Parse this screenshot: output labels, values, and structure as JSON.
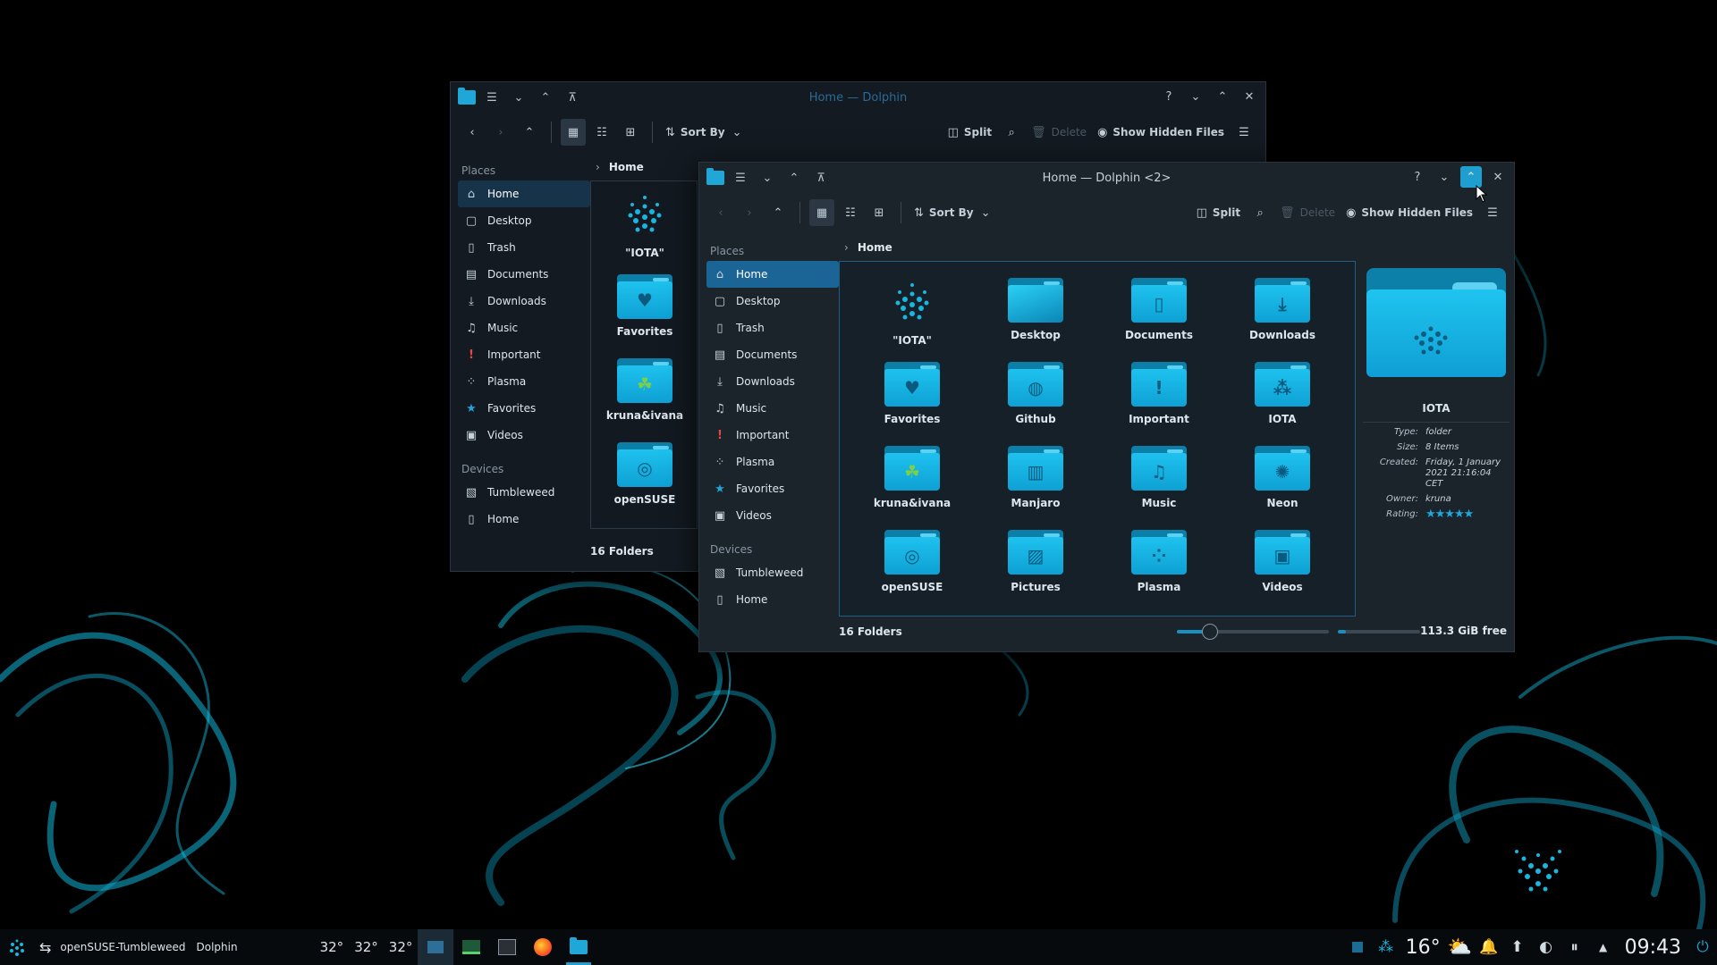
{
  "back_window": {
    "title": "Home — Dolphin",
    "toolbar": {
      "sort_label": "Sort By",
      "split_label": "Split",
      "delete_label": "Delete",
      "hidden_label": "Show Hidden Files"
    },
    "breadcrumb": "Home",
    "places_header": "Places",
    "places": [
      "Home",
      "Desktop",
      "Trash",
      "Documents",
      "Downloads",
      "Music",
      "Important",
      "Plasma",
      "Favorites",
      "Videos"
    ],
    "devices_header": "Devices",
    "devices": [
      "Tumbleweed",
      "Home"
    ],
    "items": [
      "\"IOTA\"",
      "Favorites",
      "kruna&ivana",
      "openSUSE"
    ],
    "status": "16 Folders"
  },
  "front_window": {
    "title": "Home — Dolphin <2>",
    "toolbar": {
      "sort_label": "Sort By",
      "split_label": "Split",
      "delete_label": "Delete",
      "hidden_label": "Show Hidden Files"
    },
    "breadcrumb": "Home",
    "places_header": "Places",
    "places": [
      "Home",
      "Desktop",
      "Trash",
      "Documents",
      "Downloads",
      "Music",
      "Important",
      "Plasma",
      "Favorites",
      "Videos"
    ],
    "devices_header": "Devices",
    "devices": [
      "Tumbleweed",
      "Home"
    ],
    "items": [
      "\"IOTA\"",
      "Desktop",
      "Documents",
      "Downloads",
      "Favorites",
      "Github",
      "Important",
      "IOTA",
      "kruna&ivana",
      "Manjaro",
      "Music",
      "Neon",
      "openSUSE",
      "Pictures",
      "Plasma",
      "Videos"
    ],
    "status": "16 Folders",
    "zoom_fraction": 0.22,
    "free_space_fraction": 0.1,
    "free_space": "113.3 GiB free",
    "info": {
      "name": "IOTA",
      "type_key": "Type:",
      "type": "folder",
      "size_key": "Size:",
      "size": "8 Items",
      "created_key": "Created:",
      "created": "Friday, 1 January 2021 21:16:04 CET",
      "owner_key": "Owner:",
      "owner": "kruna",
      "rating_key": "Rating:",
      "rating": 5
    }
  },
  "taskbar": {
    "activity": "openSUSE-Tumbleweed",
    "app": "Dolphin",
    "temps": [
      "32°",
      "32°",
      "32°"
    ],
    "weather_temp": "16°",
    "clock": "09:43"
  },
  "colors": {
    "accent": "#1e9fd0",
    "folder": "#12b0e2",
    "important": "#e54646"
  }
}
